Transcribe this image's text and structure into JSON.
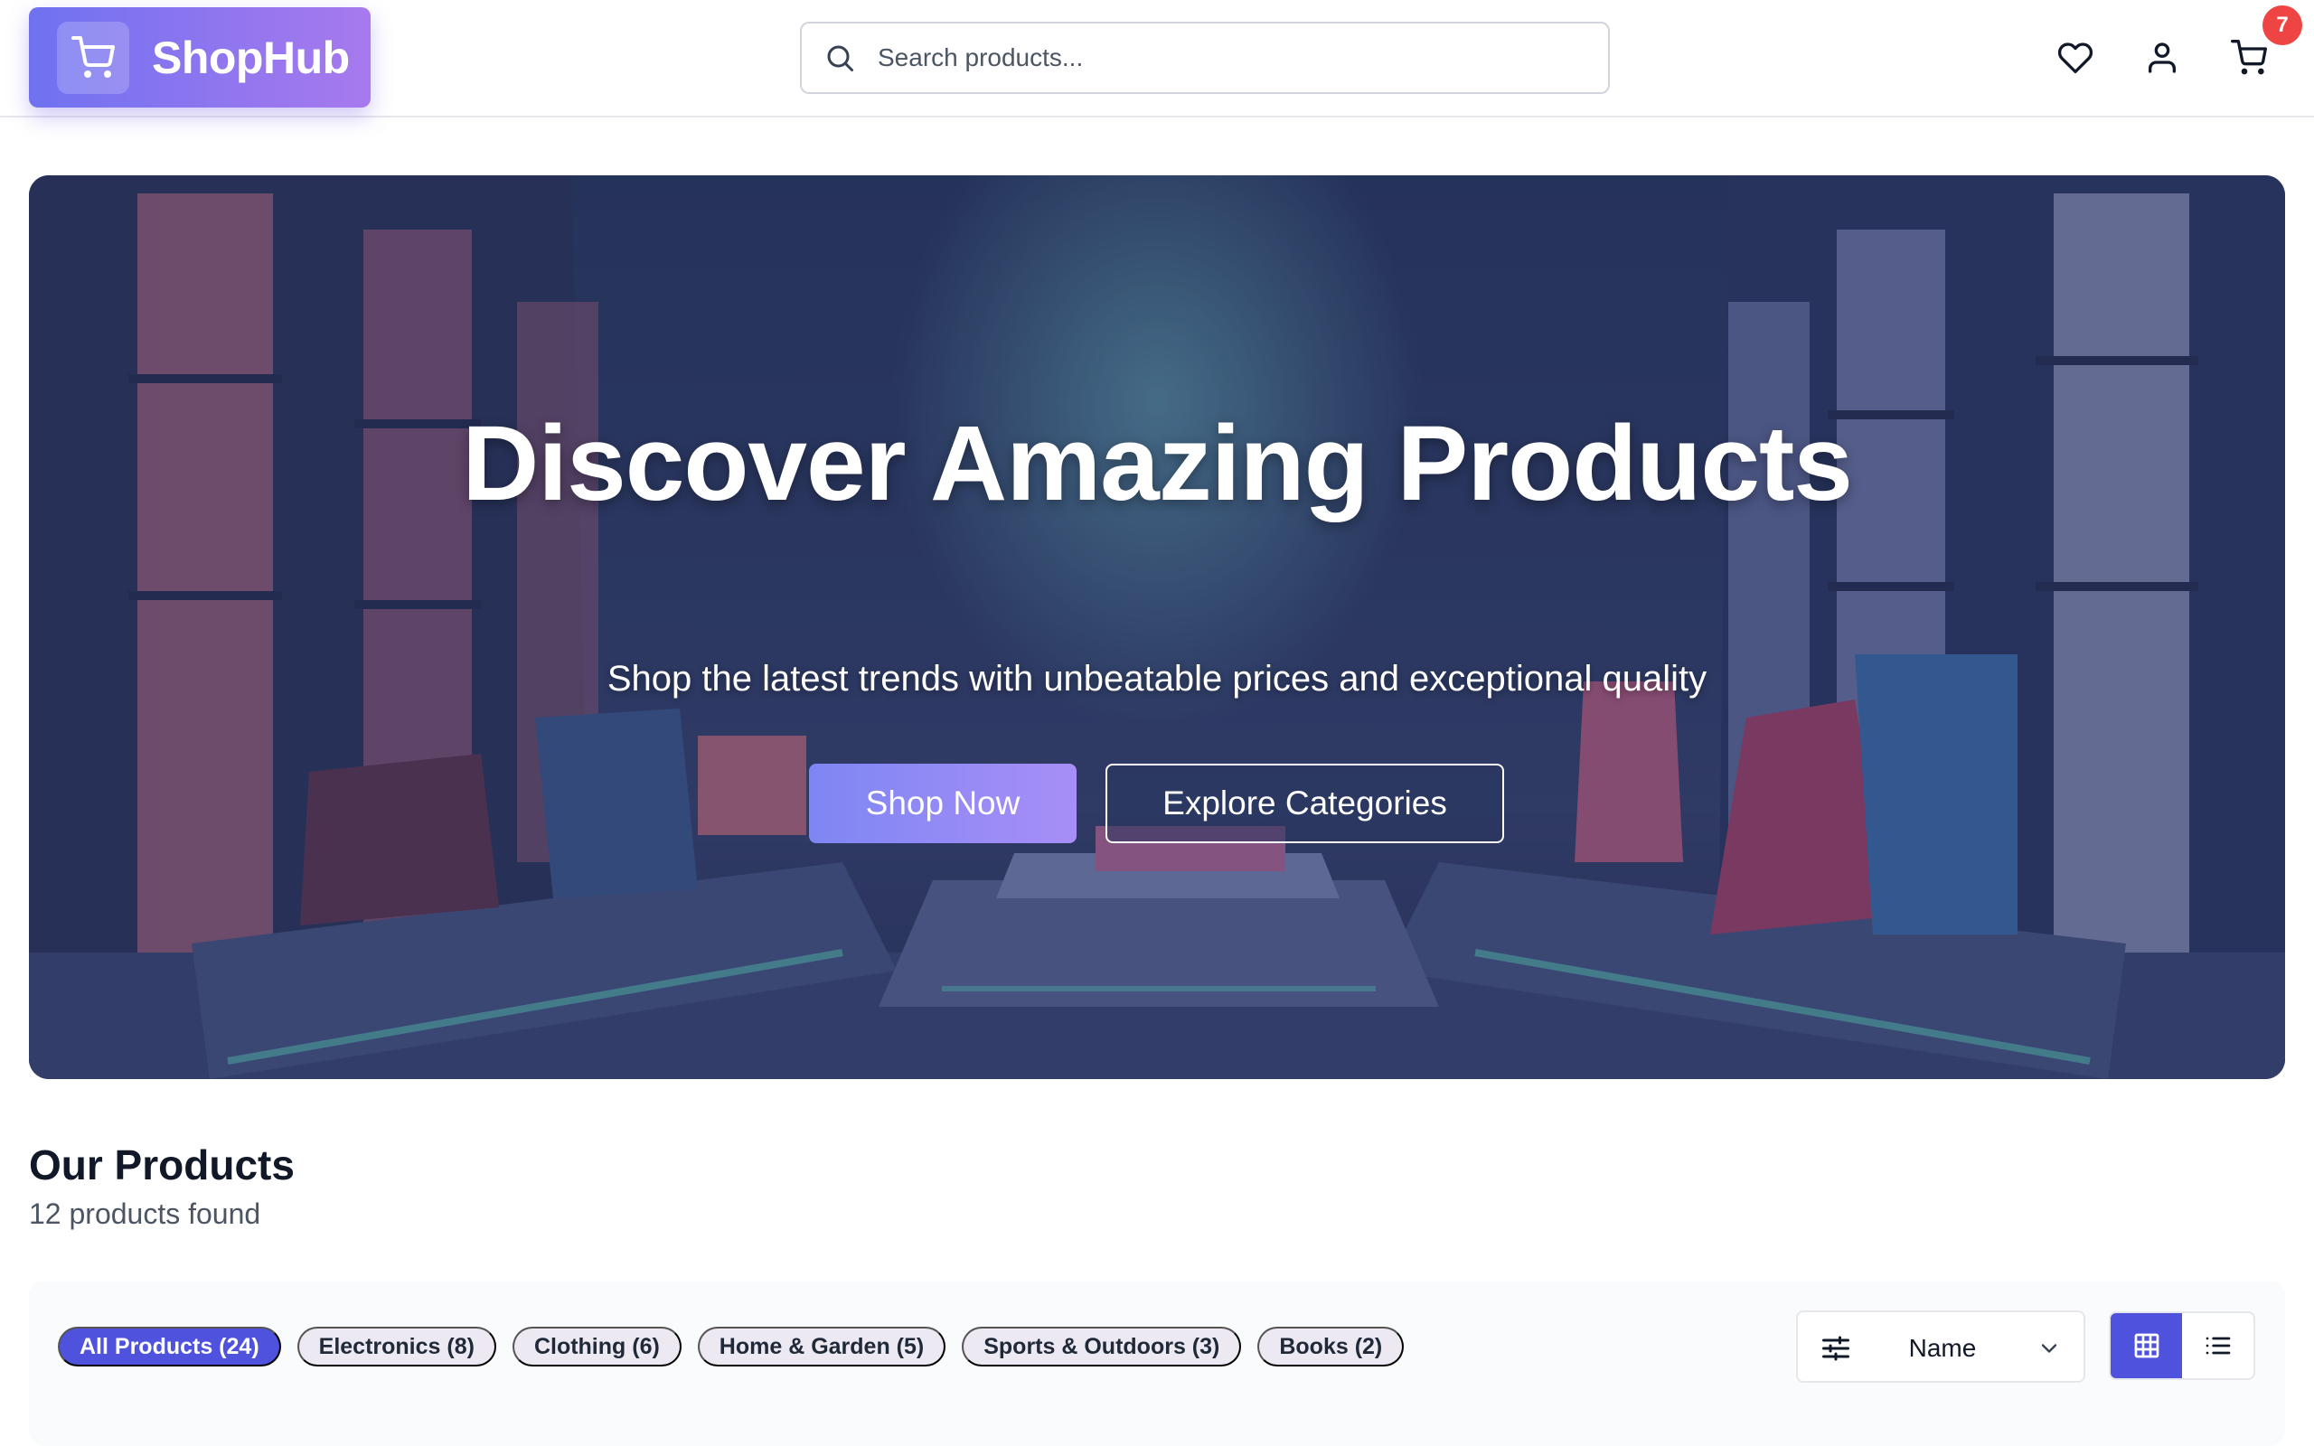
{
  "header": {
    "brand": "ShopHub",
    "search": {
      "placeholder": "Search products...",
      "value": ""
    },
    "cart_count": "7",
    "icons": [
      "cart-icon",
      "search-icon",
      "heart-icon",
      "user-icon",
      "cart-icon"
    ]
  },
  "hero": {
    "title": "Discover Amazing Products",
    "subtitle": "Shop the latest trends with unbeatable prices and exceptional quality",
    "primary_cta": "Shop Now",
    "secondary_cta": "Explore Categories"
  },
  "products": {
    "title": "Our Products",
    "count_text": "12 products found",
    "categories": [
      {
        "label": "All Products (24)",
        "active": true
      },
      {
        "label": "Electronics (8)",
        "active": false
      },
      {
        "label": "Clothing (6)",
        "active": false
      },
      {
        "label": "Home & Garden (5)",
        "active": false
      },
      {
        "label": "Sports & Outdoors (3)",
        "active": false
      },
      {
        "label": "Books (2)",
        "active": false
      }
    ],
    "sort": {
      "selected": "Name"
    },
    "view_mode": "grid"
  },
  "colors": {
    "accent": "#4f52dc",
    "logo_gradient_start": "#6f72f0",
    "logo_gradient_end": "#a879ee",
    "badge": "#ef4444"
  }
}
